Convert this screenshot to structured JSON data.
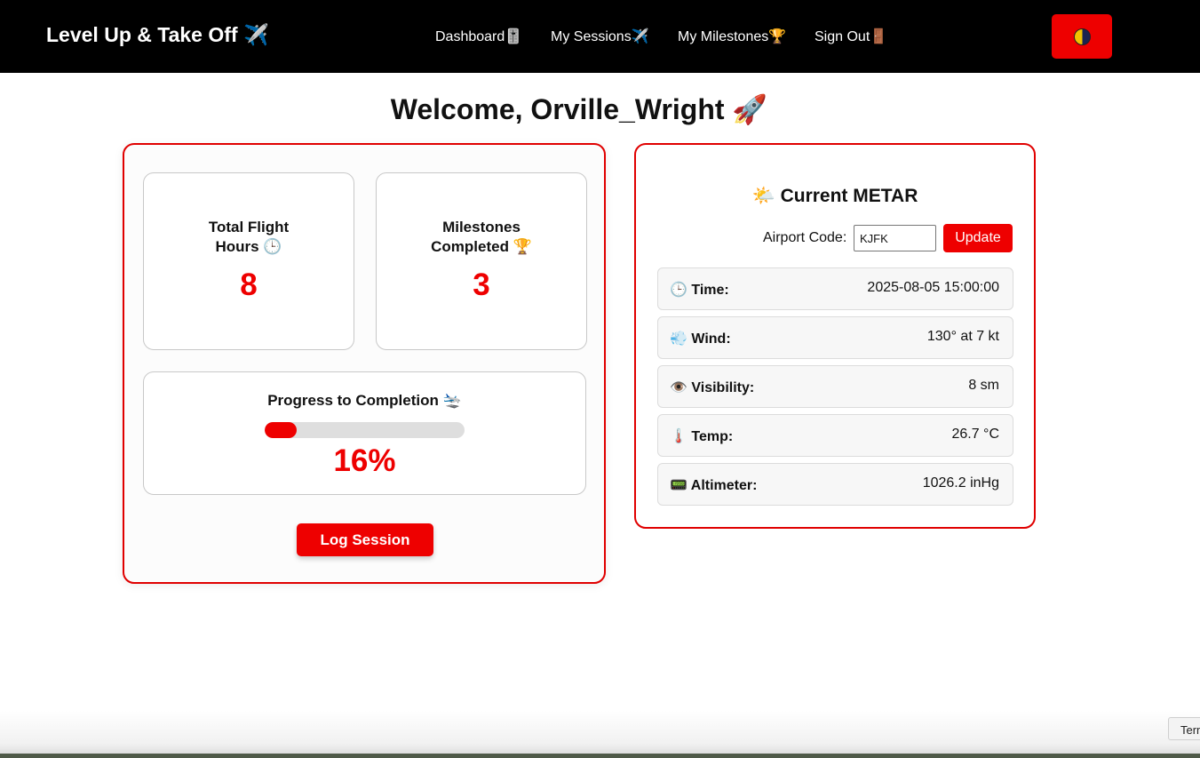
{
  "navbar": {
    "brand": "Level Up & Take Off ✈️",
    "links": [
      {
        "label": "Dashboard🎚️"
      },
      {
        "label": "My Sessions✈️"
      },
      {
        "label": "My Milestones🏆"
      },
      {
        "label": "Sign Out🚪"
      }
    ],
    "theme_toggle_icon": "half-moon-icon"
  },
  "welcome": "Welcome, Orville_Wright 🚀",
  "stats": {
    "flight_hours": {
      "label": "Total Flight Hours 🕒",
      "value": "8"
    },
    "milestones": {
      "label": "Milestones Completed 🏆",
      "value": "3"
    }
  },
  "progress": {
    "label": "Progress to Completion 🛬",
    "value": "16%",
    "fraction": 0.16
  },
  "log_button": "Log Session",
  "metar": {
    "title": "🌤️ Current METAR",
    "airport_label": "Airport Code:",
    "airport_value": "KJFK",
    "update_button": "Update",
    "rows": [
      {
        "label": "🕒 Time:",
        "value": "2025-08-05 15:00:00"
      },
      {
        "label": "💨 Wind:",
        "value": "130° at 7 kt"
      },
      {
        "label": "👁️ Visibility:",
        "value": "8 sm"
      },
      {
        "label": "🌡️ Temp:",
        "value": "26.7 °C"
      },
      {
        "label": "📟 Altimeter:",
        "value": "1026.2 inHg"
      }
    ]
  },
  "footer": {
    "terms_tab": "Terms"
  },
  "colors": {
    "accent": "#ee0000",
    "navbar": "#000000"
  }
}
